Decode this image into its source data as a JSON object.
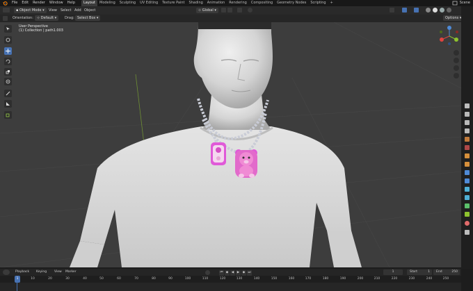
{
  "menu": [
    "File",
    "Edit",
    "Render",
    "Window",
    "Help"
  ],
  "workspaces": [
    "Layout",
    "Modeling",
    "Sculpting",
    "UV Editing",
    "Texture Paint",
    "Shading",
    "Animation",
    "Rendering",
    "Compositing",
    "Geometry Nodes",
    "Scripting"
  ],
  "active_workspace": "Layout",
  "scene_label": "Scene",
  "header": {
    "mode": "Object Mode",
    "menus": [
      "View",
      "Select",
      "Add",
      "Object"
    ],
    "transform_orientation": "Global",
    "orientation_label": "Orientation:",
    "orientation_value": "Default",
    "drag_label": "Drag:",
    "drag_value": "Select Box",
    "options_label": "Options"
  },
  "viewport": {
    "view_name": "User Perspective",
    "collection_info": "(1) Collection | path1.003"
  },
  "timeline": {
    "menus": [
      "Playback",
      "Keying",
      "View",
      "Marker"
    ],
    "current_frame": "1",
    "start_label": "Start",
    "start_value": "1",
    "end_label": "End",
    "end_value": "250",
    "ticks": [
      "1",
      "10",
      "20",
      "30",
      "40",
      "50",
      "60",
      "70",
      "80",
      "90",
      "100",
      "110",
      "120",
      "130",
      "140",
      "150",
      "160",
      "170",
      "180",
      "190",
      "200",
      "210",
      "220",
      "230",
      "240",
      "250"
    ]
  },
  "colors": {
    "accent": "#4772b3",
    "viewport_bg": "#3d3d3d",
    "x_axis": "#e0443f",
    "y_axis": "#8ec22e",
    "z_axis": "#4f8ad6"
  }
}
